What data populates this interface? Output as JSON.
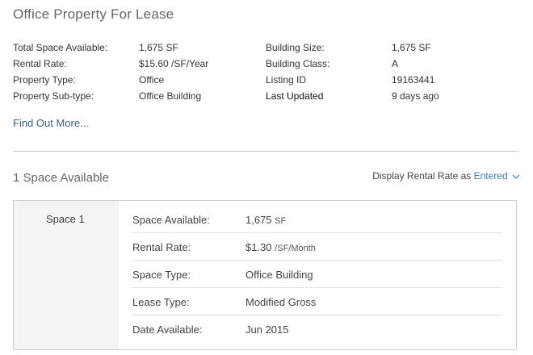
{
  "header": {
    "title": "Office Property For Lease"
  },
  "facts": [
    {
      "label": "Total Space Available:",
      "value": "1,675 SF",
      "label2": "Building Size:",
      "value2": "1,675 SF"
    },
    {
      "label": "Rental Rate:",
      "value": "$15.60 /SF/Year",
      "label2": "Building Class:",
      "value2": "A"
    },
    {
      "label": "Property Type:",
      "value": "Office",
      "label2": "Listing ID",
      "value2": "19163441"
    },
    {
      "label": "Property Sub-type:",
      "value": "Office Building",
      "label2": "Last Updated",
      "value2": "9 days ago"
    }
  ],
  "find_more": "Find Out More...",
  "spaces": {
    "title": "1 Space Available",
    "display_rate_prefix": "Display Rental Rate as",
    "display_rate_value": "Entered",
    "items": [
      {
        "name": "Space 1",
        "rows": [
          {
            "label": "Space Available:",
            "value": "1,675",
            "unit": "SF"
          },
          {
            "label": "Rental Rate:",
            "value": "$1.30",
            "unit": "/SF/Month"
          },
          {
            "label": "Space Type:",
            "value": "Office Building",
            "unit": ""
          },
          {
            "label": "Lease Type:",
            "value": "Modified Gross",
            "unit": ""
          },
          {
            "label": "Date Available:",
            "value": "Jun 2015",
            "unit": ""
          }
        ]
      }
    ]
  },
  "colors": {
    "link": "#3a5f86",
    "accent": "#3a79c1",
    "divider": "#c8c8c8",
    "panel": "#f4f4f4"
  }
}
